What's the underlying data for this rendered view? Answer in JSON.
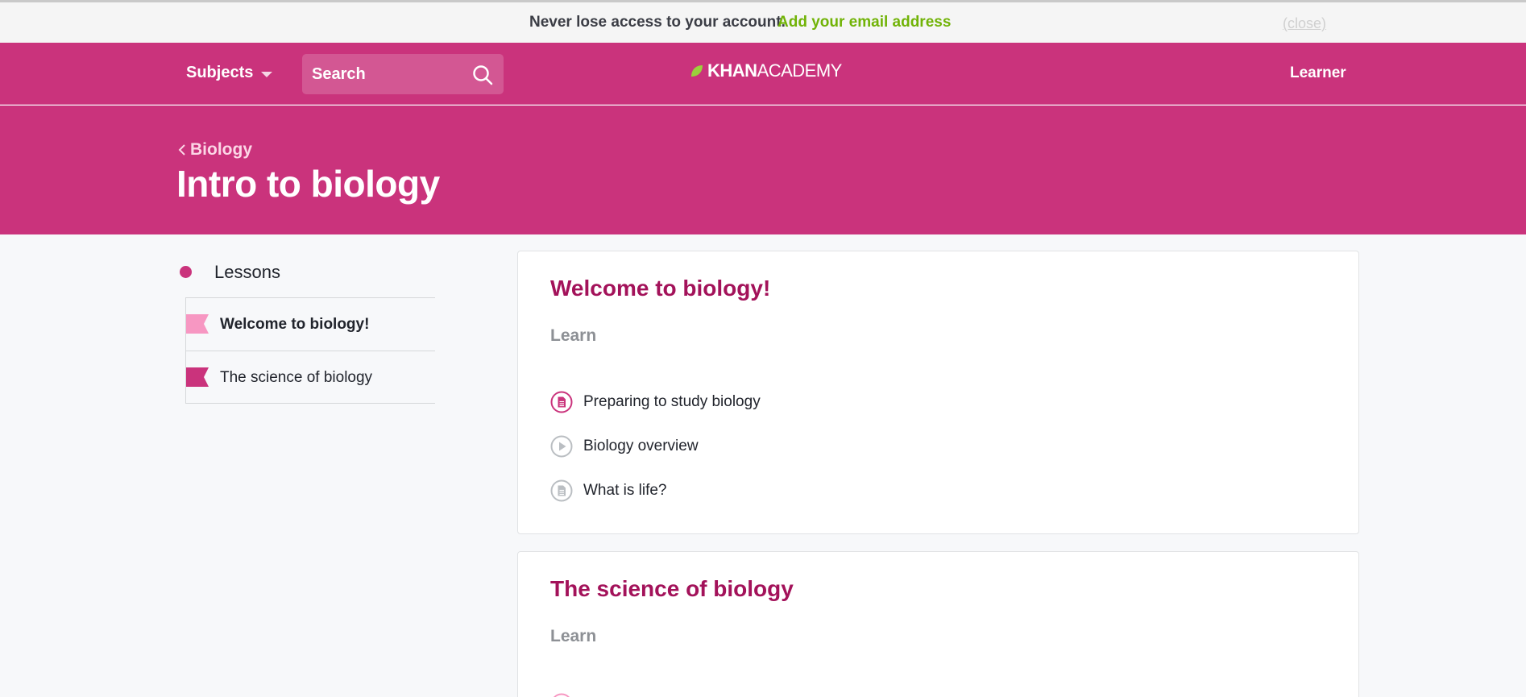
{
  "notice": {
    "message": "Never lose access to your account.",
    "link": "Add your email address",
    "close": "(close)"
  },
  "nav": {
    "subjects": "Subjects",
    "search_placeholder": "Search",
    "logo_bold": "KHAN",
    "logo_light": "ACADEMY",
    "user": "Learner"
  },
  "header": {
    "breadcrumb": "Biology",
    "title": "Intro to biology"
  },
  "sidebar": {
    "heading": "Lessons",
    "items": [
      {
        "label": "Welcome to biology!",
        "active": true
      },
      {
        "label": "The science of biology",
        "active": false
      }
    ]
  },
  "units": [
    {
      "title": "Welcome to biology!",
      "section": "Learn",
      "items": [
        {
          "label": "Preparing to study biology",
          "icon": "article-icon"
        },
        {
          "label": "Biology overview",
          "icon": "video-play-icon"
        },
        {
          "label": "What is life?",
          "icon": "article-icon"
        }
      ]
    },
    {
      "title": "The science of biology",
      "section": "Learn",
      "items": []
    }
  ],
  "colors": {
    "brand": "#ca337c",
    "unit_title": "#a3125a",
    "notice_link": "#71b307",
    "flag_light": "#f797c2",
    "flag_dark": "#ca337c"
  }
}
